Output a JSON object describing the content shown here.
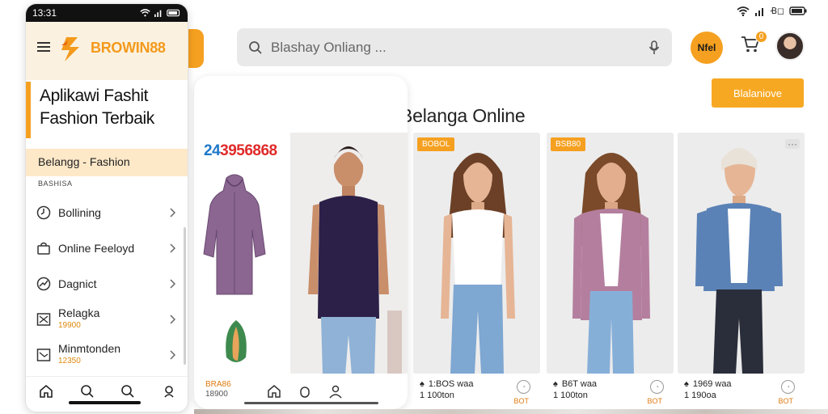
{
  "status": {
    "time": "13:31"
  },
  "app": {
    "brand": "BROWIN88",
    "hero_title_line1": "Aplikawi Fashit",
    "hero_title_line2": "Fashion Terbaik",
    "category": "Belangg - Fashion",
    "section_label": "BASHISA",
    "menu": [
      {
        "label": "Bollining",
        "sub": "",
        "icon": "clock-icon"
      },
      {
        "label": "Online Feeloyd",
        "sub": "",
        "icon": "bag-icon"
      },
      {
        "label": "Dagnict",
        "sub": "",
        "icon": "chart-icon"
      },
      {
        "label": "Relagka",
        "sub": "19900",
        "icon": "cross-icon"
      },
      {
        "label": "Minmtonden",
        "sub": "12350",
        "icon": "document-icon"
      }
    ]
  },
  "topbar": {
    "search_placeholder": "Blashay Onliang ...",
    "round_button": "Nfel",
    "cart_count": "0",
    "cta_label": "Blalaniove"
  },
  "main": {
    "title": "Aplipasm Terbaan yatur Belanga Online",
    "promo_number_part1": "24",
    "promo_number_part2": "3956868",
    "promo_price": "BRA86",
    "promo_price_sub": "18900"
  },
  "products": [
    {
      "badge": "BOBOL",
      "name": "1:BOS waa",
      "price": "1 100ton",
      "coin": "BOT"
    },
    {
      "badge": "BSB80",
      "name": "B6T waa",
      "price": "1 100ton",
      "coin": "BOT"
    },
    {
      "badge": "",
      "name": "1969 waa",
      "price": "1 190oa",
      "coin": "BOT"
    }
  ],
  "colors": {
    "accent": "#f5a020",
    "hero_bg": "#fbf1e0",
    "category_bg": "#fde8c8"
  }
}
